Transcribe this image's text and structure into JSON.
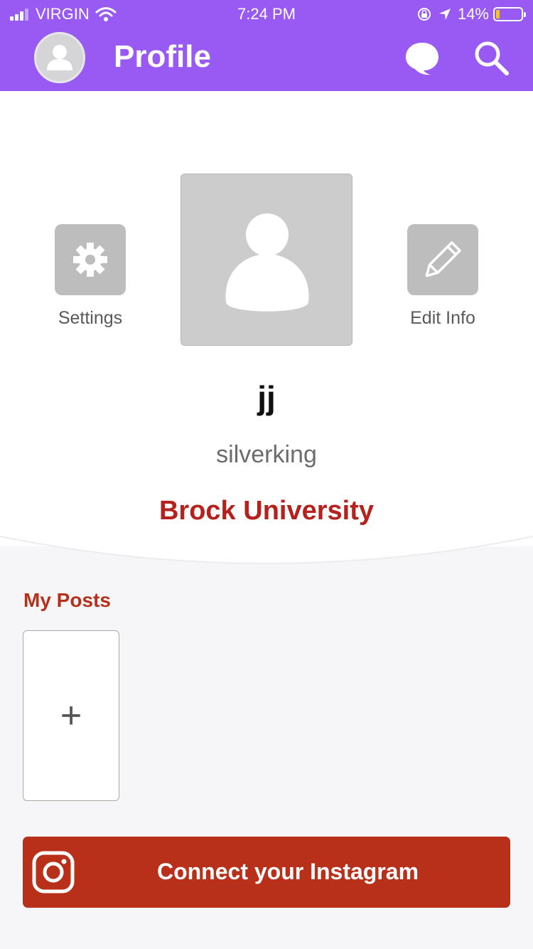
{
  "status_bar": {
    "carrier": "VIRGIN",
    "time": "7:24 PM",
    "battery": "14%",
    "battery_level": 0.14,
    "icons": [
      "signal-icon",
      "wifi-icon",
      "orientation-lock-icon",
      "location-arrow-icon",
      "battery-icon"
    ]
  },
  "header": {
    "title": "Profile",
    "avatar_icon": "user-avatar-icon",
    "chat_icon": "chat-bubble-icon",
    "search_icon": "search-icon",
    "background": "#985af2"
  },
  "profile": {
    "settings_label": "Settings",
    "edit_label": "Edit Info",
    "display_name": "jj",
    "username": "silverking",
    "school": "Brock University",
    "school_color": "#b5211c",
    "photo_icon": "user-placeholder-icon"
  },
  "posts": {
    "title": "My Posts",
    "add_symbol": "+"
  },
  "instagram": {
    "label": "Connect your Instagram",
    "icon": "instagram-icon",
    "color": "#b8301a"
  }
}
